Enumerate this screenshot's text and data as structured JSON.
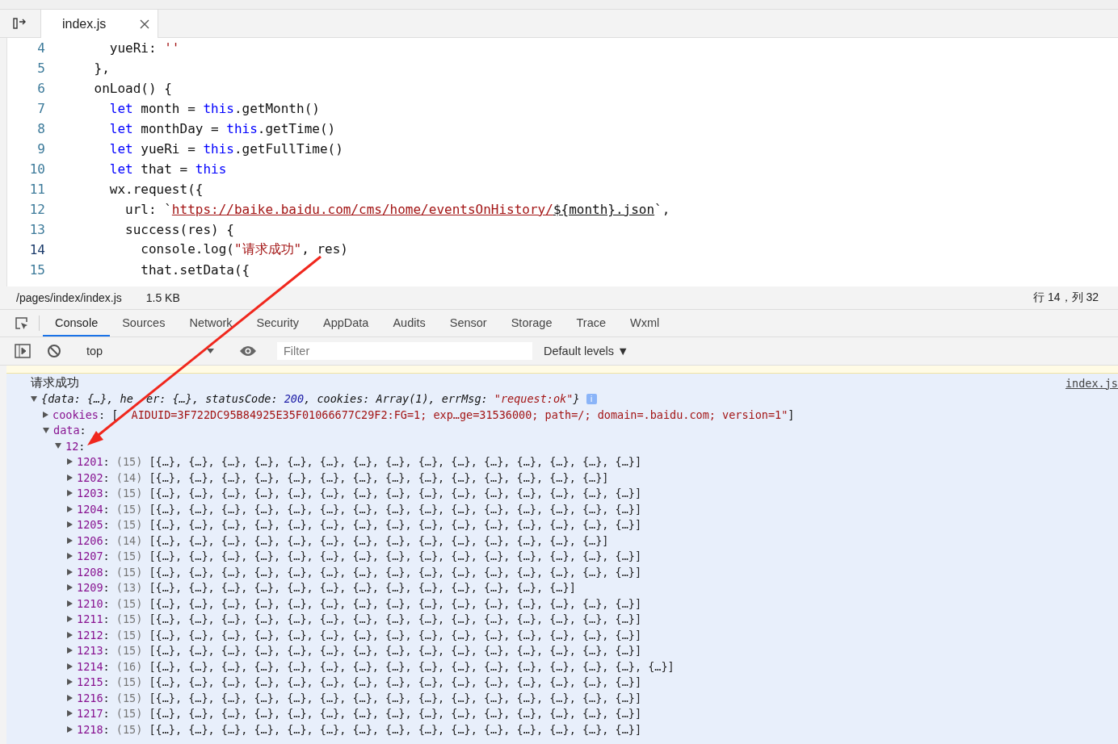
{
  "editor": {
    "tab": {
      "label": "index.js",
      "selected": true
    },
    "lines": [
      {
        "number": "4",
        "current": false,
        "tokens": [
          {
            "text": "      yueRi: ",
            "kind": "plain"
          },
          {
            "text": "''",
            "kind": "string"
          }
        ]
      },
      {
        "number": "5",
        "current": false,
        "tokens": [
          {
            "text": "    },",
            "kind": "plain"
          }
        ]
      },
      {
        "number": "6",
        "current": false,
        "tokens": [
          {
            "text": "    onLoad() {",
            "kind": "plain"
          }
        ]
      },
      {
        "number": "7",
        "current": false,
        "tokens": [
          {
            "text": "      let",
            "kind": "keyword"
          },
          {
            "text": " month = ",
            "kind": "plain"
          },
          {
            "text": "this",
            "kind": "keyword"
          },
          {
            "text": ".getMonth()",
            "kind": "plain"
          }
        ]
      },
      {
        "number": "8",
        "current": false,
        "tokens": [
          {
            "text": "      let",
            "kind": "keyword"
          },
          {
            "text": " monthDay = ",
            "kind": "plain"
          },
          {
            "text": "this",
            "kind": "keyword"
          },
          {
            "text": ".getTime()",
            "kind": "plain"
          }
        ]
      },
      {
        "number": "9",
        "current": false,
        "tokens": [
          {
            "text": "      let",
            "kind": "keyword"
          },
          {
            "text": " yueRi = ",
            "kind": "plain"
          },
          {
            "text": "this",
            "kind": "keyword"
          },
          {
            "text": ".getFullTime()",
            "kind": "plain"
          }
        ]
      },
      {
        "number": "10",
        "current": false,
        "tokens": [
          {
            "text": "      let",
            "kind": "keyword"
          },
          {
            "text": " that = ",
            "kind": "plain"
          },
          {
            "text": "this",
            "kind": "keyword"
          }
        ]
      },
      {
        "number": "11",
        "current": false,
        "tokens": [
          {
            "text": "      wx.request({",
            "kind": "plain"
          }
        ]
      },
      {
        "number": "12",
        "current": false,
        "tokens": [
          {
            "text": "        url: `",
            "kind": "plain"
          },
          {
            "text": "https://baike.baidu.com/cms/home/eventsOnHistory/",
            "kind": "url"
          },
          {
            "text": "${month}.json",
            "kind": "template"
          },
          {
            "text": "`,",
            "kind": "plain"
          }
        ]
      },
      {
        "number": "13",
        "current": false,
        "tokens": [
          {
            "text": "        success(res) {",
            "kind": "plain"
          }
        ]
      },
      {
        "number": "14",
        "current": true,
        "tokens": [
          {
            "text": "          console.log(",
            "kind": "plain"
          },
          {
            "text": "\"请求成功\"",
            "kind": "string"
          },
          {
            "text": ", res)",
            "kind": "plain"
          }
        ]
      },
      {
        "number": "15",
        "current": false,
        "tokens": [
          {
            "text": "          that.setData({",
            "kind": "plain"
          }
        ]
      }
    ]
  },
  "status_bar": {
    "path": "/pages/index/index.js",
    "size": "1.5 KB",
    "cursor": "行 14，列 32"
  },
  "devtools_tabs": [
    {
      "label": "Console",
      "selected": true
    },
    {
      "label": "Sources",
      "selected": false
    },
    {
      "label": "Network",
      "selected": false
    },
    {
      "label": "Security",
      "selected": false
    },
    {
      "label": "AppData",
      "selected": false
    },
    {
      "label": "Audits",
      "selected": false
    },
    {
      "label": "Sensor",
      "selected": false
    },
    {
      "label": "Storage",
      "selected": false
    },
    {
      "label": "Trace",
      "selected": false
    },
    {
      "label": "Wxml",
      "selected": false
    }
  ],
  "console_toolbar": {
    "context": "top",
    "filter_placeholder": "Filter",
    "levels": "Default levels ▼"
  },
  "console": {
    "message": "请求成功",
    "source": "index.js",
    "tree": [
      {
        "expanded": true,
        "summary": [
          {
            "text": "{data: {…}, he",
            "kind": "plain"
          },
          {
            "kind": "covered"
          },
          {
            "text": "er: {…}, statusCode: ",
            "kind": "plain"
          },
          {
            "text": "200",
            "kind": "number"
          },
          {
            "text": ", cookies: Array(1), errMsg: ",
            "kind": "plain"
          },
          {
            "text": "\"request:ok\"",
            "kind": "string"
          },
          {
            "text": "}",
            "kind": "plain"
          }
        ],
        "info": "i",
        "children": [
          {
            "key": "cookies",
            "colon": ":",
            "expanded": false,
            "value": [
              {
                "text": "[",
                "kind": "plain"
              },
              {
                "kind": "covered"
              },
              {
                "text": "AIDUID=3F722DC95B84925E35F01066677C29F2:FG=1; exp…ge=31536000; path=/; domain=.baidu.com; version=1\"",
                "kind": "string"
              },
              {
                "text": "]",
                "kind": "plain"
              }
            ]
          },
          {
            "key": "data",
            "colon": ":",
            "expanded": true,
            "children": [
              {
                "key": "12",
                "colon": ":",
                "expanded": true,
                "children": [
                  {
                    "key": "1201",
                    "colon": ":",
                    "expanded": false,
                    "count": "(15)",
                    "preview": "[{…}, {…}, {…}, {…}, {…}, {…}, {…}, {…}, {…}, {…}, {…}, {…}, {…}, {…}, {…}]"
                  },
                  {
                    "key": "1202",
                    "colon": ":",
                    "expanded": false,
                    "count": "(14)",
                    "preview": "[{…}, {…}, {…}, {…}, {…}, {…}, {…}, {…}, {…}, {…}, {…}, {…}, {…}, {…}]"
                  },
                  {
                    "key": "1203",
                    "colon": ":",
                    "expanded": false,
                    "count": "(15)",
                    "preview": "[{…}, {…}, {…}, {…}, {…}, {…}, {…}, {…}, {…}, {…}, {…}, {…}, {…}, {…}, {…}]"
                  },
                  {
                    "key": "1204",
                    "colon": ":",
                    "expanded": false,
                    "count": "(15)",
                    "preview": "[{…}, {…}, {…}, {…}, {…}, {…}, {…}, {…}, {…}, {…}, {…}, {…}, {…}, {…}, {…}]"
                  },
                  {
                    "key": "1205",
                    "colon": ":",
                    "expanded": false,
                    "count": "(15)",
                    "preview": "[{…}, {…}, {…}, {…}, {…}, {…}, {…}, {…}, {…}, {…}, {…}, {…}, {…}, {…}, {…}]"
                  },
                  {
                    "key": "1206",
                    "colon": ":",
                    "expanded": false,
                    "count": "(14)",
                    "preview": "[{…}, {…}, {…}, {…}, {…}, {…}, {…}, {…}, {…}, {…}, {…}, {…}, {…}, {…}]"
                  },
                  {
                    "key": "1207",
                    "colon": ":",
                    "expanded": false,
                    "count": "(15)",
                    "preview": "[{…}, {…}, {…}, {…}, {…}, {…}, {…}, {…}, {…}, {…}, {…}, {…}, {…}, {…}, {…}]"
                  },
                  {
                    "key": "1208",
                    "colon": ":",
                    "expanded": false,
                    "count": "(15)",
                    "preview": "[{…}, {…}, {…}, {…}, {…}, {…}, {…}, {…}, {…}, {…}, {…}, {…}, {…}, {…}, {…}]"
                  },
                  {
                    "key": "1209",
                    "colon": ":",
                    "expanded": false,
                    "count": "(13)",
                    "preview": "[{…}, {…}, {…}, {…}, {…}, {…}, {…}, {…}, {…}, {…}, {…}, {…}, {…}]"
                  },
                  {
                    "key": "1210",
                    "colon": ":",
                    "expanded": false,
                    "count": "(15)",
                    "preview": "[{…}, {…}, {…}, {…}, {…}, {…}, {…}, {…}, {…}, {…}, {…}, {…}, {…}, {…}, {…}]"
                  },
                  {
                    "key": "1211",
                    "colon": ":",
                    "expanded": false,
                    "count": "(15)",
                    "preview": "[{…}, {…}, {…}, {…}, {…}, {…}, {…}, {…}, {…}, {…}, {…}, {…}, {…}, {…}, {…}]"
                  },
                  {
                    "key": "1212",
                    "colon": ":",
                    "expanded": false,
                    "count": "(15)",
                    "preview": "[{…}, {…}, {…}, {…}, {…}, {…}, {…}, {…}, {…}, {…}, {…}, {…}, {…}, {…}, {…}]"
                  },
                  {
                    "key": "1213",
                    "colon": ":",
                    "expanded": false,
                    "count": "(15)",
                    "preview": "[{…}, {…}, {…}, {…}, {…}, {…}, {…}, {…}, {…}, {…}, {…}, {…}, {…}, {…}, {…}]"
                  },
                  {
                    "key": "1214",
                    "colon": ":",
                    "expanded": false,
                    "count": "(16)",
                    "preview": "[{…}, {…}, {…}, {…}, {…}, {…}, {…}, {…}, {…}, {…}, {…}, {…}, {…}, {…}, {…}, {…}]"
                  },
                  {
                    "key": "1215",
                    "colon": ":",
                    "expanded": false,
                    "count": "(15)",
                    "preview": "[{…}, {…}, {…}, {…}, {…}, {…}, {…}, {…}, {…}, {…}, {…}, {…}, {…}, {…}, {…}]"
                  },
                  {
                    "key": "1216",
                    "colon": ":",
                    "expanded": false,
                    "count": "(15)",
                    "preview": "[{…}, {…}, {…}, {…}, {…}, {…}, {…}, {…}, {…}, {…}, {…}, {…}, {…}, {…}, {…}]"
                  },
                  {
                    "key": "1217",
                    "colon": ":",
                    "expanded": false,
                    "count": "(15)",
                    "preview": "[{…}, {…}, {…}, {…}, {…}, {…}, {…}, {…}, {…}, {…}, {…}, {…}, {…}, {…}, {…}]"
                  },
                  {
                    "key": "1218",
                    "colon": ":",
                    "expanded": false,
                    "count": "(15)",
                    "preview": "[{…}, {…}, {…}, {…}, {…}, {…}, {…}, {…}, {…}, {…}, {…}, {…}, {…}, {…}, {…}]"
                  }
                ]
              }
            ]
          }
        ]
      }
    ]
  }
}
